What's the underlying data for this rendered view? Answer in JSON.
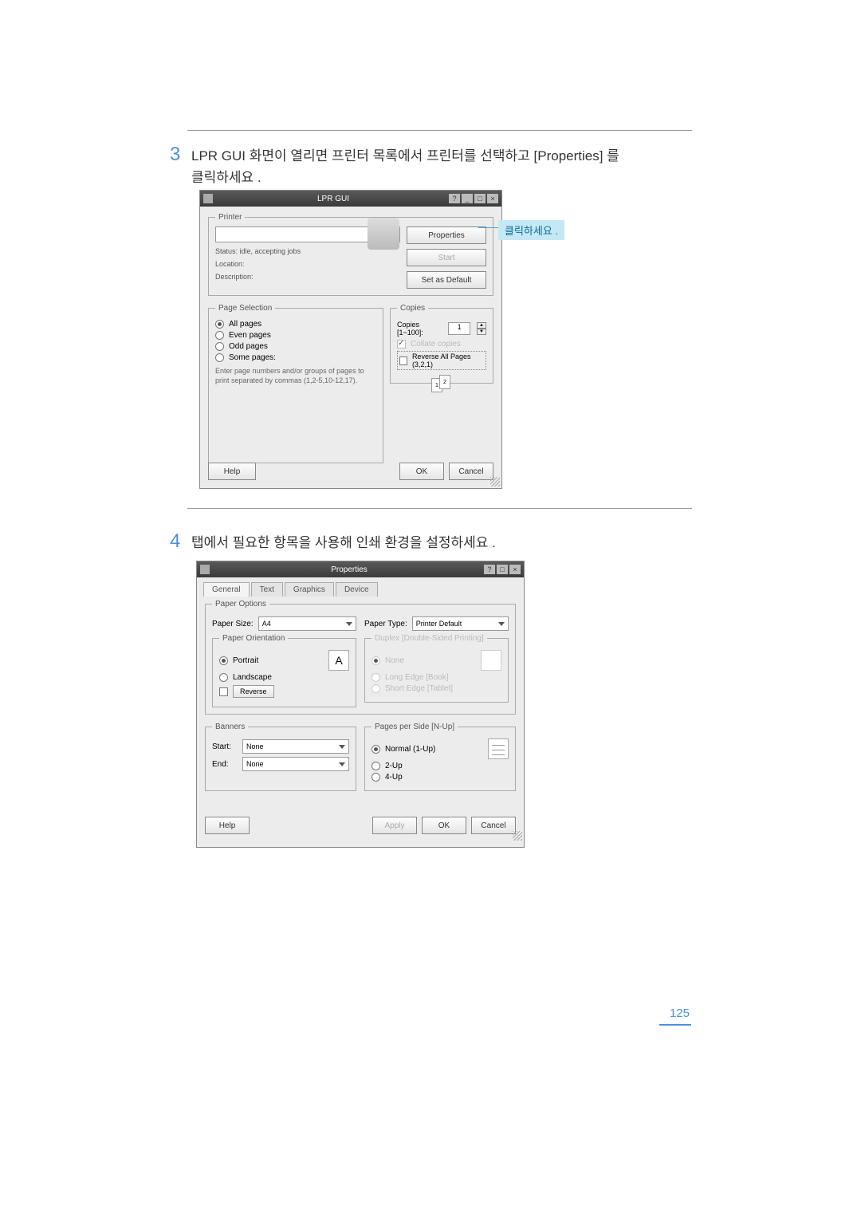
{
  "step3": {
    "num": "3",
    "text": "LPR GUI 화면이 열리면 프린터 목록에서 프린터를 선택하고 [Properties] 를 클릭하세요 ."
  },
  "step4": {
    "num": "4",
    "text": "탭에서 필요한 항목을 사용해 인쇄 환경을 설정하세요 ."
  },
  "callout": "클릭하세요 .",
  "page_num": "125",
  "win1": {
    "title": "LPR GUI",
    "printer_legend": "Printer",
    "status": "Status: idle, accepting jobs",
    "location": "Location:",
    "description": "Description:",
    "btn_properties": "Properties",
    "btn_start": "Start",
    "btn_default": "Set as Default",
    "page_sel_legend": "Page Selection",
    "all_pages": "All pages",
    "even_pages": "Even pages",
    "odd_pages": "Odd pages",
    "some_pages": "Some pages:",
    "hint": "Enter page numbers and/or groups of pages to print separated by commas (1,2-5,10-12,17).",
    "copies_legend": "Copies",
    "copies_label": "Copies [1~100]:",
    "copies_value": "1",
    "collate": "Collate copies",
    "reverse": "Reverse All Pages (3,2,1)",
    "help": "Help",
    "ok": "OK",
    "cancel": "Cancel"
  },
  "win2": {
    "title": "Properties",
    "tabs": {
      "general": "General",
      "text": "Text",
      "graphics": "Graphics",
      "device": "Device"
    },
    "paper_options": "Paper Options",
    "paper_size_lbl": "Paper Size:",
    "paper_size_val": "A4",
    "paper_type_lbl": "Paper Type:",
    "paper_type_val": "Printer Default",
    "paper_orient": "Paper Orientation",
    "portrait": "Portrait",
    "landscape": "Landscape",
    "reverse": "Reverse",
    "duplex": "Duplex [Double-Sided Printing]",
    "none": "None",
    "long_edge": "Long Edge [Book]",
    "short_edge": "Short Edge [Tablet]",
    "banners": "Banners",
    "start_lbl": "Start:",
    "end_lbl": "End:",
    "none_val": "None",
    "pps": "Pages per Side [N-Up]",
    "n1": "Normal (1-Up)",
    "n2": "2-Up",
    "n4": "4-Up",
    "help": "Help",
    "apply": "Apply",
    "ok": "OK",
    "cancel": "Cancel"
  }
}
